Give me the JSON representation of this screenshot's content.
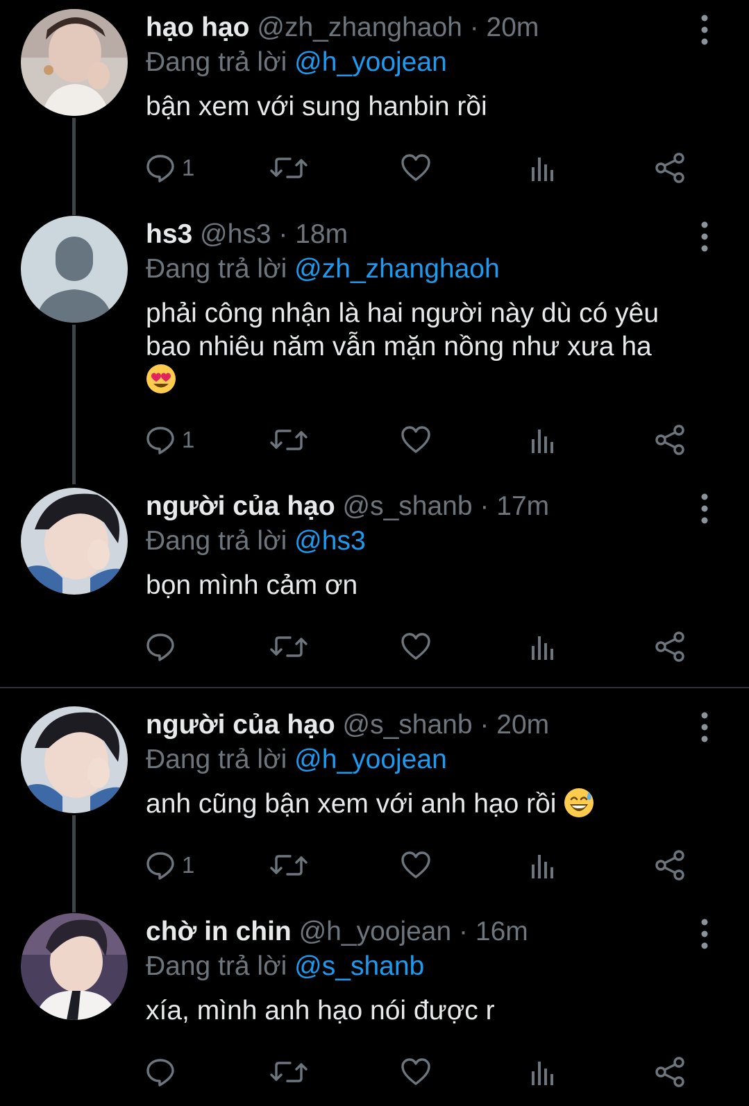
{
  "tweets": [
    {
      "name": "hạo hạo",
      "handle": "@zh_zhanghaoh",
      "dot": "·",
      "time": "20m",
      "replying_prefix": "Đang trả lời",
      "replying_to": "@h_yoojean",
      "text": "bận xem với sung hanbin rồi",
      "reply_count": "1"
    },
    {
      "name": "hs3",
      "handle": "@hs3",
      "dot": "·",
      "time": "18m",
      "replying_prefix": "Đang trả lời",
      "replying_to": "@zh_zhanghaoh",
      "text_line1": "phải công nhận là hai người này dù có yêu",
      "text_line2": "bao nhiêu năm vẫn mặn nồng như xưa ha",
      "emoji": "heart-eyes-emoji",
      "reply_count": "1"
    },
    {
      "name": "người của hạo",
      "handle": "@s_shanb",
      "dot": "·",
      "time": "17m",
      "replying_prefix": "Đang trả lời",
      "replying_to": "@hs3",
      "text": "bọn mình cảm ơn",
      "reply_count": ""
    },
    {
      "name": "người của hạo",
      "handle": "@s_shanb",
      "dot": "·",
      "time": "20m",
      "replying_prefix": "Đang trả lời",
      "replying_to": "@h_yoojean",
      "text": "anh cũng bận xem với anh hạo rồi",
      "emoji": "grinning-sweat-emoji",
      "reply_count": "1"
    },
    {
      "name": "chờ in chin",
      "handle": "@h_yoojean",
      "dot": "·",
      "time": "16m",
      "replying_prefix": "Đang trả lời",
      "replying_to": "@s_shanb",
      "text": "xía, mình anh hạo nói được r",
      "reply_count": ""
    }
  ],
  "colors": {
    "background": "#000000",
    "text": "#e7e9ea",
    "secondary": "#6e767d",
    "link": "#1d9bf0",
    "connector": "#3f4448",
    "divider": "#2f3336"
  }
}
